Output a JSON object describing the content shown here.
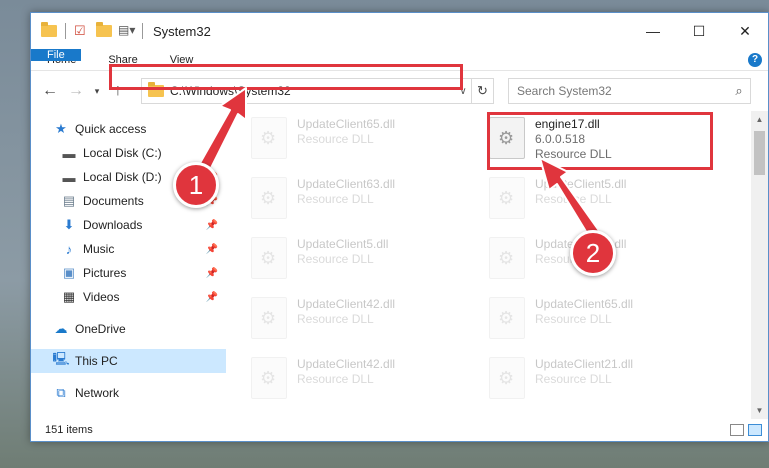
{
  "window": {
    "title": "System32",
    "controls": {
      "minimize": "—",
      "maximize": "☐",
      "close": "✕"
    }
  },
  "ribbon": {
    "tabs": [
      "File",
      "Home",
      "Share",
      "View"
    ],
    "help": "?"
  },
  "address": {
    "path": "C:\\Windows\\System32",
    "search_placeholder": "Search System32"
  },
  "sidebar": {
    "items": [
      {
        "label": "Quick access",
        "icon": "star-icon"
      },
      {
        "label": "Local Disk (C:)",
        "icon": "drive-icon"
      },
      {
        "label": "Local Disk (D:)",
        "icon": "drive-icon"
      },
      {
        "label": "Documents",
        "icon": "documents-icon"
      },
      {
        "label": "Downloads",
        "icon": "download-icon"
      },
      {
        "label": "Music",
        "icon": "music-icon"
      },
      {
        "label": "Pictures",
        "icon": "pictures-icon"
      },
      {
        "label": "Videos",
        "icon": "videos-icon"
      },
      {
        "label": "OneDrive",
        "icon": "cloud-icon"
      },
      {
        "label": "This PC",
        "icon": "computer-icon"
      },
      {
        "label": "Network",
        "icon": "network-icon"
      }
    ]
  },
  "files": [
    {
      "name": "UpdateClient65.dll",
      "type": "Resource DLL"
    },
    {
      "name": "engine17.dll",
      "version": "6.0.0.518",
      "type": "Resource DLL"
    },
    {
      "name": "UpdateClient63.dll",
      "type": "Resource DLL"
    },
    {
      "name": "UpdateClient5.dll",
      "type": "Resource DLL"
    },
    {
      "name": "UpdateClient5.dll",
      "type": "Resource DLL"
    },
    {
      "name": "UpdateClient5.dll",
      "type": "Resource DLL"
    },
    {
      "name": "UpdateClient42.dll",
      "type": "Resource DLL"
    },
    {
      "name": "UpdateClient65.dll",
      "type": "Resource DLL"
    },
    {
      "name": "UpdateClient42.dll",
      "type": "Resource DLL"
    },
    {
      "name": "UpdateClient21.dll",
      "type": "Resource DLL"
    }
  ],
  "status": {
    "count": "151 items"
  },
  "annotations": {
    "step1": "1",
    "step2": "2",
    "color": "#e0353d"
  }
}
